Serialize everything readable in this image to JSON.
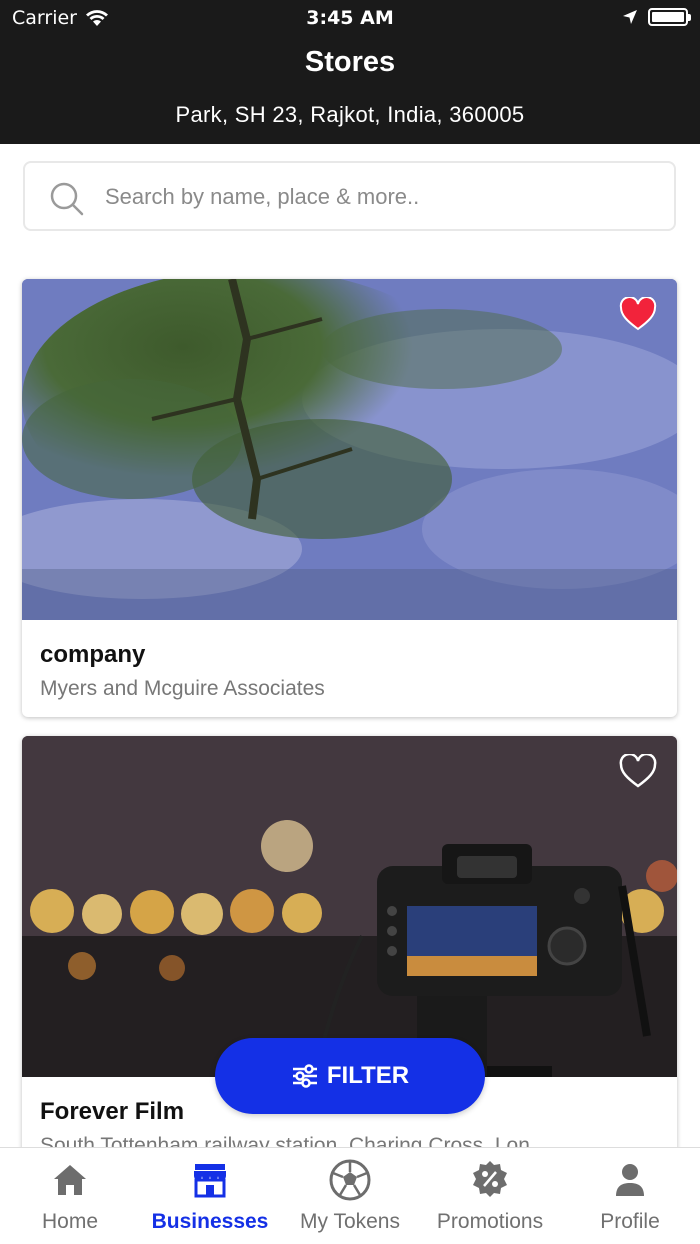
{
  "status_bar": {
    "carrier": "Carrier",
    "time": "3:45 AM"
  },
  "header": {
    "title": "Stores",
    "location": "Park, SH 23, Rajkot, India, 360005"
  },
  "search": {
    "placeholder": "Search by name, place & more.."
  },
  "stores": [
    {
      "name": "company",
      "address": "Myers and Mcguire Associates",
      "favorite": true
    },
    {
      "name": "Forever Film",
      "address": "South Tottenham railway station, Charing Cross, Lon",
      "favorite": false
    }
  ],
  "filter": {
    "label": "FILTER"
  },
  "tabs": [
    {
      "label": "Home",
      "icon": "home-icon"
    },
    {
      "label": "Businesses",
      "icon": "store-icon",
      "active": true
    },
    {
      "label": "My Tokens",
      "icon": "soccer-ball-icon"
    },
    {
      "label": "Promotions",
      "icon": "percent-badge-icon"
    },
    {
      "label": "Profile",
      "icon": "person-icon"
    }
  ],
  "colors": {
    "accent": "#1430e6",
    "header_bg": "#1a1a1a",
    "favorite": "#f2233b"
  }
}
